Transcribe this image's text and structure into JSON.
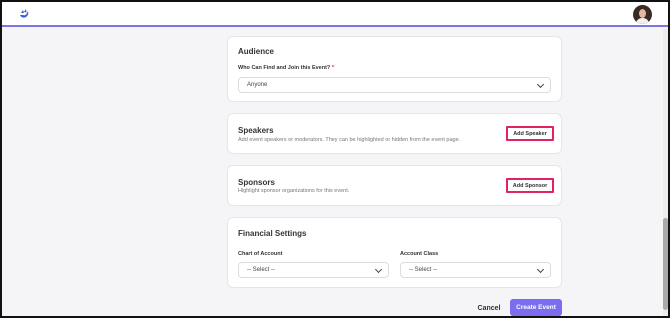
{
  "header": {
    "logo_icon": "brand-logo-icon",
    "avatar_icon": "user-avatar-icon"
  },
  "audience": {
    "title": "Audience",
    "field_label": "Who Can Find and Join this Event?",
    "required_mark": "*",
    "selected": "Anyone"
  },
  "speakers": {
    "title": "Speakers",
    "description": "Add event speakers or moderators. They can be highlighted or hidden from the event page.",
    "button_label": "Add Speaker"
  },
  "sponsors": {
    "title": "Sponsors",
    "description": "Highlight sponsor organizations for this event.",
    "button_label": "Add Sponsor"
  },
  "financial": {
    "title": "Financial Settings",
    "chart_of_account_label": "Chart of Account",
    "chart_of_account_value": "-- Select --",
    "account_class_label": "Account Class",
    "account_class_value": "-- Select --"
  },
  "footer": {
    "cancel_label": "Cancel",
    "create_label": "Create Event"
  },
  "colors": {
    "accent": "#7b6cf0",
    "highlight_border": "#e0245e",
    "required": "#d0273e"
  }
}
